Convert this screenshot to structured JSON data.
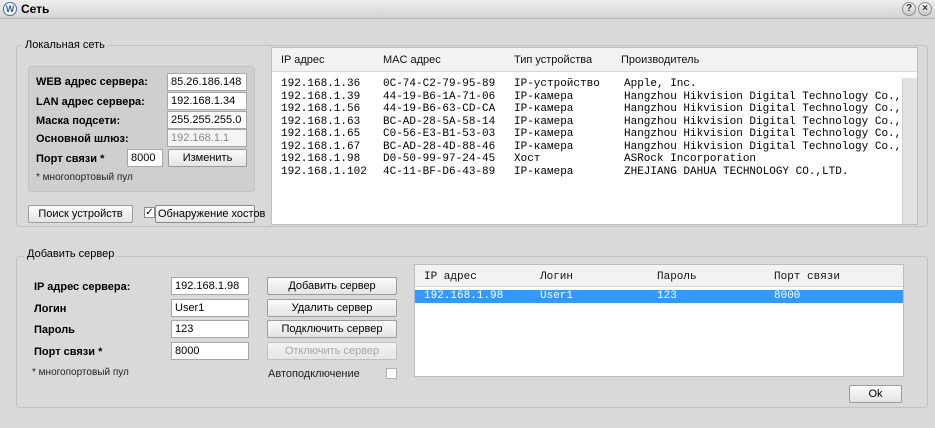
{
  "window": {
    "title": "Сеть",
    "help_label": "?",
    "close_label": "×"
  },
  "local_network": {
    "group_title": "Локальная сеть",
    "web_label": "WEB адрес сервера:",
    "web_value": "85.26.186.148",
    "lan_label": "LAN адрес сервера:",
    "lan_value": "192.168.1.34",
    "mask_label": "Маска подсети:",
    "mask_value": "255.255.255.0",
    "gateway_label": "Основной шлюз:",
    "gateway_value": "192.168.1.1",
    "port_label": "Порт связи *",
    "port_value": "8000",
    "change_button": "Изменить",
    "note": "* многопортовый пул",
    "search_button": "Поиск устройств",
    "detect_check": "✓",
    "detect_label": "Обнаружение хостов"
  },
  "devices": {
    "headers": [
      "IP адрес",
      "MAC адрес",
      "Тип устройства",
      "Производитель"
    ],
    "rows": [
      [
        "192.168.1.36",
        "0C-74-C2-79-95-89",
        "IP-устройство",
        "Apple, Inc."
      ],
      [
        "192.168.1.39",
        "44-19-B6-1A-71-06",
        "IP-камера",
        "Hangzhou Hikvision Digital Technology Co.,Ltd"
      ],
      [
        "192.168.1.56",
        "44-19-B6-63-CD-CA",
        "IP-камера",
        "Hangzhou Hikvision Digital Technology Co.,Ltd"
      ],
      [
        "192.168.1.63",
        "BC-AD-28-5A-58-14",
        "IP-камера",
        "Hangzhou Hikvision Digital Technology Co.,Ltd"
      ],
      [
        "192.168.1.65",
        "C0-56-E3-B1-53-03",
        "IP-камера",
        "Hangzhou Hikvision Digital Technology Co.,Ltd"
      ],
      [
        "192.168.1.67",
        "BC-AD-28-4D-88-46",
        "IP-камера",
        "Hangzhou Hikvision Digital Technology Co.,Ltd"
      ],
      [
        "192.168.1.98",
        "D0-50-99-97-24-45",
        "Хост",
        "ASRock Incorporation"
      ],
      [
        "192.168.1.102",
        "4C-11-BF-D6-43-89",
        "IP-камера",
        "ZHEJIANG DAHUA TECHNOLOGY CO.,LTD."
      ]
    ]
  },
  "add_server": {
    "group_title": "Добавить сервер",
    "ip_label": "IP адрес сервера:",
    "ip_value": "192.168.1.98",
    "login_label": "Логин",
    "login_value": "User1",
    "password_label": "Пароль",
    "password_value": "123",
    "port_label": "Порт связи *",
    "port_value": "8000",
    "note": "* многопортовый пул",
    "add_button": "Добавить сервер",
    "delete_button": "Удалить сервер",
    "connect_button": "Подключить сервер",
    "disconnect_button": "Отключить сервер",
    "autoconnect_label": "Автоподключение"
  },
  "servers": {
    "headers": [
      "IP адрес",
      "Логин",
      "Пароль",
      "Порт связи"
    ],
    "rows": [
      [
        "192.168.1.98",
        "User1",
        "123",
        "8000"
      ]
    ]
  },
  "ok_button": "Ok",
  "colors": {
    "selection": "#3399ff",
    "background": "#d9d9d9"
  }
}
